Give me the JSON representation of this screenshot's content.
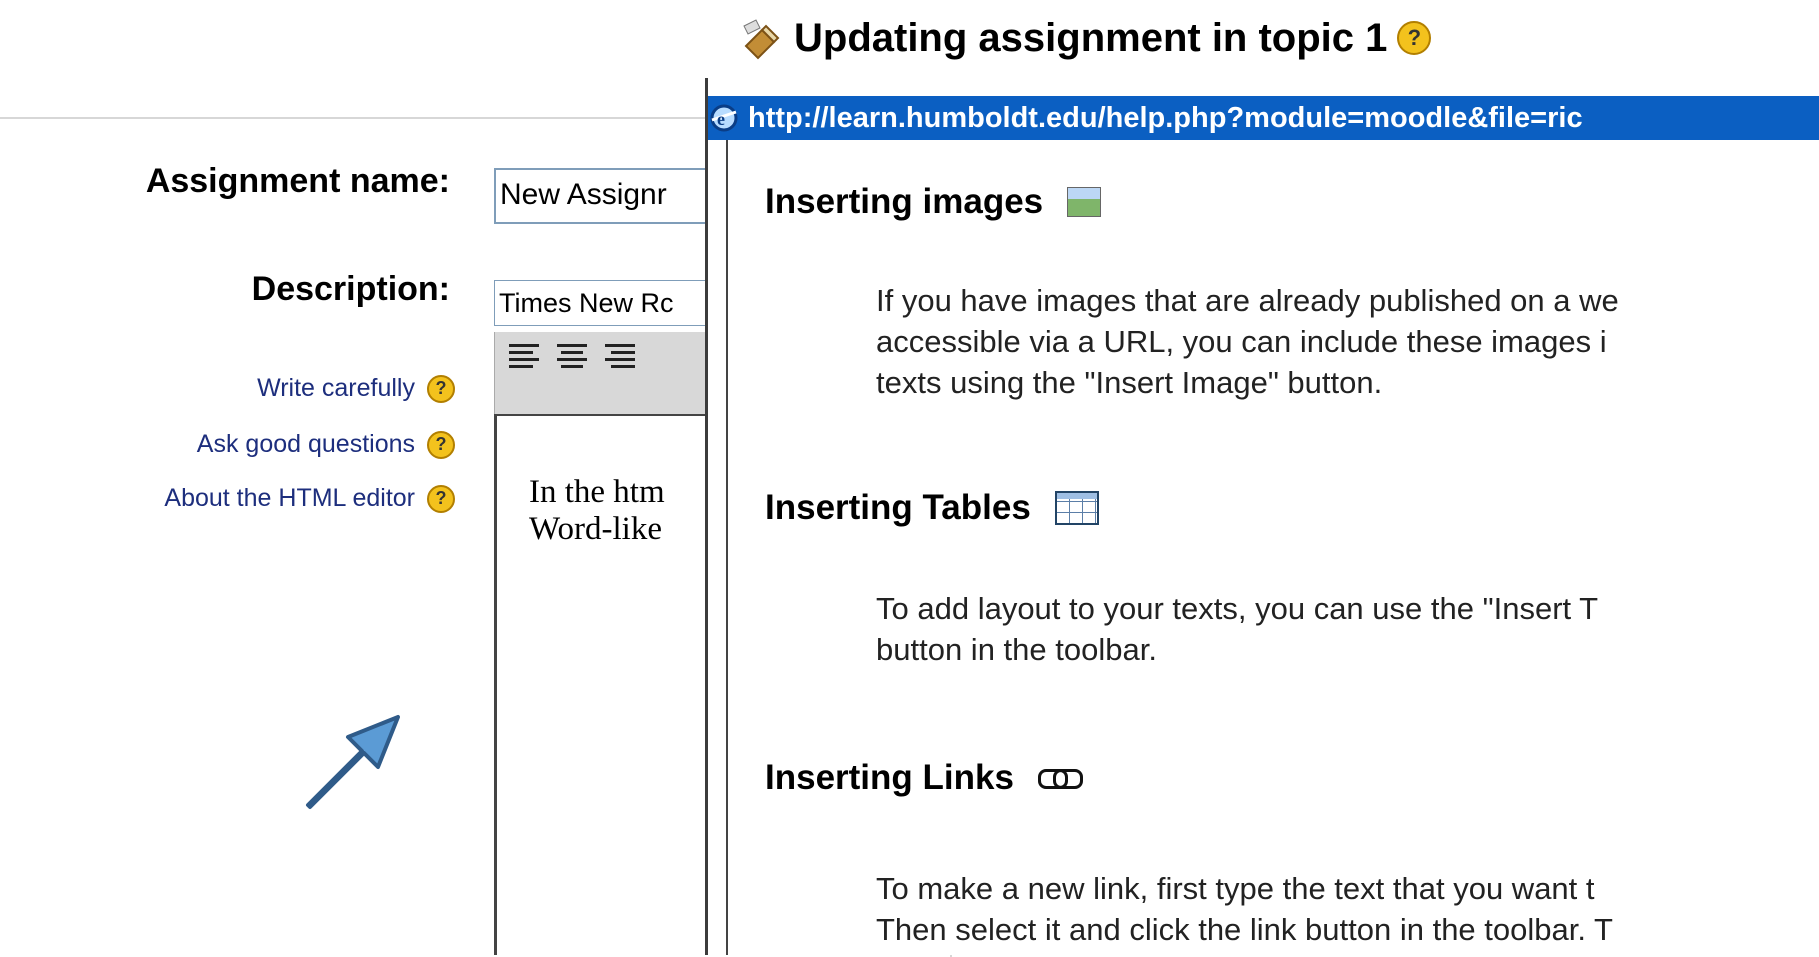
{
  "header": {
    "title": "Updating assignment in topic 1",
    "help_mark": "?"
  },
  "form": {
    "assignment_label": "Assignment name:",
    "assignment_value": "New Assignr",
    "description_label": "Description:",
    "font_value": "Times New Rc",
    "editor_text_line1": "In the htm",
    "editor_text_line2": "Word-like",
    "help_links": [
      {
        "label": "Write carefully",
        "mark": "?"
      },
      {
        "label": "Ask good questions",
        "mark": "?"
      },
      {
        "label": "About the HTML editor",
        "mark": "?"
      }
    ]
  },
  "popup": {
    "url": "http://learn.humboldt.edu/help.php?module=moodle&file=ric",
    "sections": [
      {
        "title": "Inserting images",
        "lines": [
          "If you have images that are already published on a we",
          "accessible via a URL, you can include these images i",
          "texts using the \"Insert Image\" button."
        ],
        "icon": "image-icon"
      },
      {
        "title": "Inserting Tables",
        "lines": [
          "To add layout to your texts, you can use the \"Insert T",
          "button in the toolbar."
        ],
        "icon": "table-icon"
      },
      {
        "title": "Inserting Links",
        "lines": [
          "To make a new link, first type the text that you want t",
          "Then select it and click the link button in the toolbar. T"
        ],
        "icon": "link-icon"
      }
    ]
  },
  "colors": {
    "titlebar": "#0b5fc2",
    "help_link": "#1d2e7d",
    "help_icon": "#f3c21d",
    "arrow": "#5b9bd5"
  }
}
